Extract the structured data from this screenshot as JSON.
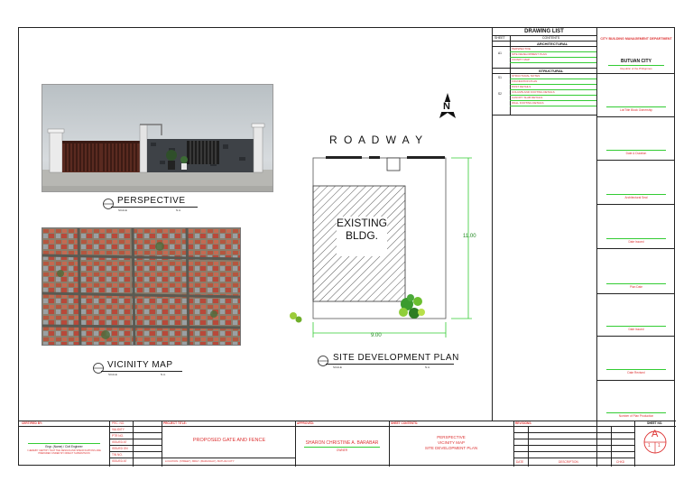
{
  "drawing": {
    "perspective_title": "PERSPECTIVE",
    "vicinity_title": "VICINITY MAP",
    "site_plan_title": "SITE DEVELOPMENT PLAN",
    "scale_label": "SCALE",
    "scale_value": "N.A.",
    "roadway": "R O A D W A Y",
    "existing_bldg_line1": "EXISTING",
    "existing_bldg_line2": "BLDG.",
    "dim_vertical": "11.00",
    "dim_horizontal": "9.00",
    "north_label": "N"
  },
  "drawing_list": {
    "title": "DRAWING LIST",
    "col_sheet": "SHEET",
    "col_contents": "CONTENTS",
    "architectural_header": "ARCHITECTURAL",
    "architectural_items": [
      "PERSPECTIVE",
      "SITE DEVELOPMENT PLAN",
      "VICINITY MAP"
    ],
    "architectural_sheet": "A1",
    "structural_header": "STRUCTURAL",
    "structural_items": [
      "STRUCTURAL NOTES",
      "FOUNDATION PLAN",
      "POST DETAILS",
      "COLUMN AND FOOTING DETAILS",
      "CANOPY SLAB DETAILS",
      "WALL FOOTING DETAILS"
    ],
    "structural_sheets": [
      "S1",
      "S2"
    ]
  },
  "title_block_right": {
    "office": "CITY BUILDING MANAGEMENT DEPARTMENT",
    "city": "BUTUAN CITY",
    "city_sub": "Republic of the Philippines",
    "fields": [
      "Lot/Title Block Ownership",
      "Date & Duration",
      "Architectural Seal",
      "Date Issued",
      "Plan Date",
      "Date Issued",
      "Date Revised",
      "Number of Plan Production"
    ]
  },
  "title_block_bottom": {
    "certified_by": "CERTIFIED BY:",
    "prc_labels": [
      "PRC. NO.",
      "VALIDITY",
      "PTR NO.",
      "ISSUED AT",
      "ISSUED ON",
      "TIN NO.",
      "ISSUED AT"
    ],
    "certifier_name": "Engr. (Name) / Civil Engineer",
    "certifier_note": "I HEREBY CERTIFY THAT THE DESIGN AND SPECIFICATIONS ARE PREPARED UNDER MY DIRECT SUPERVISION",
    "project_title_label": "PROJECT TITLE:",
    "project_title": "PROPOSED GATE AND FENCE",
    "project_location": "LOCATION: (STREET), BRGY. (BARANGAY), BUTUAN CITY",
    "approved_label": "APPROVED:",
    "approved_name": "SHARON CHRISTINE A. BARABAR",
    "approved_role": "OWNER",
    "sheet_contents_label": "SHEET CONTENTS:",
    "sheet_contents": [
      "PERSPECTIVE",
      "VICINITY MAP",
      "SITE DEVELOPMENT PLAN"
    ],
    "revisions_label": "REVISIONS:",
    "revision_cols": [
      "DATE",
      "DESCRIPTION",
      "CHKD"
    ],
    "sheet_no_label": "SHEET NO.",
    "sheet_no_top": "A",
    "sheet_no_bottom": "1",
    "sheet_no_of": "1"
  }
}
